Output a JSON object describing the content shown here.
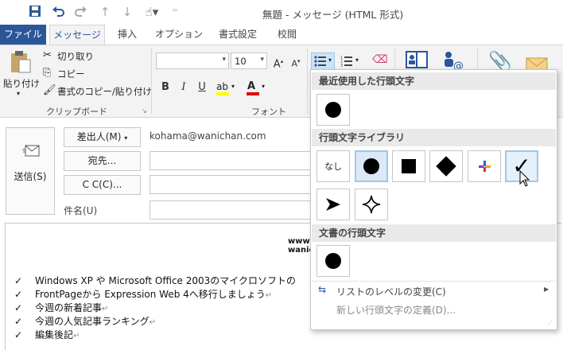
{
  "window": {
    "title": "無題 - メッセージ (HTML 形式)"
  },
  "quick_access": {
    "save_icon": "save-icon",
    "undo_icon": "undo-icon",
    "redo_icon": "redo-icon",
    "up_icon": "arrow-up-icon",
    "down_icon": "arrow-down-icon",
    "touch_icon": "touch-mode-icon"
  },
  "tabs": [
    {
      "label": "ファイル"
    },
    {
      "label": "メッセージ"
    },
    {
      "label": "挿入"
    },
    {
      "label": "オプション"
    },
    {
      "label": "書式設定"
    },
    {
      "label": "校閲"
    }
  ],
  "ribbon": {
    "clipboard": {
      "paste": "貼り付け",
      "cut": "切り取り",
      "copy": "コピー",
      "format_painter": "書式のコピー/貼り付け",
      "group_label": "クリップボード"
    },
    "font": {
      "font_name": "",
      "font_size": "10",
      "grow": "A",
      "shrink": "A",
      "bold": "B",
      "italic": "I",
      "underline": "U",
      "group_label": "フォント"
    }
  },
  "compose": {
    "send": "送信(S)",
    "from_button": "差出人(M)",
    "from_value": "kohama@wanichan.com",
    "to_button": "宛先...",
    "cc_button": "C C(C)...",
    "subject_label": "件名(U)",
    "body_bold_lines": [
      "www",
      "wanic"
    ],
    "body_lines": [
      {
        "check": "✓",
        "text": "Windows XP や Microsoft Office 2003のマイクロソフトの"
      },
      {
        "check": "✓",
        "text": "FrontPageから Expression Web 4へ移行しましょう"
      },
      {
        "check": "✓",
        "text": "今週の新着記事"
      },
      {
        "check": "✓",
        "text": "今週の人気記事ランキング"
      },
      {
        "check": "✓",
        "text": "編集後記"
      }
    ]
  },
  "bullet_menu": {
    "recent_heading": "最近使用した行頭文字",
    "library_heading": "行頭文字ライブラリ",
    "document_heading": "文書の行頭文字",
    "none_label": "なし",
    "library_items": [
      "none",
      "filled-circle",
      "filled-square",
      "filled-diamond",
      "colored-cross",
      "checkmark",
      "arrowhead",
      "four-point-star"
    ],
    "checkmark_glyph": "✓",
    "change_level": "リストのレベルの変更(C)",
    "define_new": "新しい行頭文字の定義(D)..."
  },
  "colors": {
    "accent": "#2b579a",
    "highlight": "#ffff00",
    "font_color": "#e00000",
    "selection": "#dbe9f7"
  }
}
